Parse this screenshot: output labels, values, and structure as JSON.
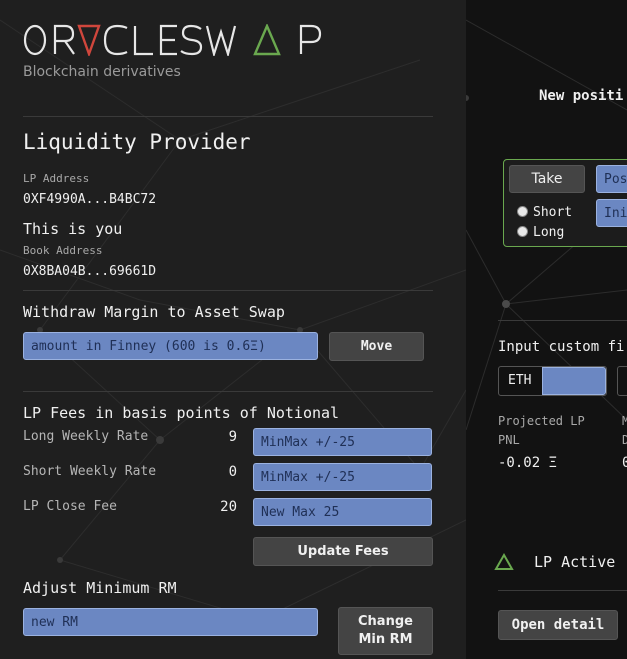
{
  "brand": {
    "logo_text": "ORACLESWAP",
    "tagline": "Blockchain derivatives"
  },
  "lp": {
    "title": "Liquidity Provider",
    "lp_address_label": "LP Address",
    "lp_address": "0XF4990A...B4BC72",
    "this_is_you": "This is you",
    "book_address_label": "Book Address",
    "book_address": "0X8BA04B...69661D"
  },
  "withdraw": {
    "title": "Withdraw Margin to Asset Swap",
    "placeholder": "amount in Finney (600 is 0.6Ξ)",
    "button": "Move"
  },
  "fees": {
    "title": "LP Fees in basis points of Notional",
    "rows": [
      {
        "label": "Long Weekly Rate",
        "value": "9",
        "placeholder": "MinMax +/-25"
      },
      {
        "label": "Short Weekly Rate",
        "value": "0",
        "placeholder": "MinMax +/-25"
      },
      {
        "label": "LP Close Fee",
        "value": "20",
        "placeholder": "New Max 25"
      }
    ],
    "update_button": "Update Fees"
  },
  "rm": {
    "title": "Adjust Minimum RM",
    "placeholder": "new RM",
    "button_line1": "Change",
    "button_line2": "Min RM"
  },
  "right": {
    "new_position": "New positi",
    "take_button": "Take",
    "pos_input": "Pos",
    "ini_input": "Ini",
    "short_label": "Short",
    "long_label": "Long",
    "custom_title": "Input custom fi",
    "eth_label": "ETH",
    "projected_label_1": "Projected LP",
    "projected_label_2": "PNL",
    "projected_value": "-0.02 Ξ",
    "col2_label_1": "M",
    "col2_label_2": "D",
    "col2_value": "0",
    "lp_active": "LP Active",
    "open_detail": "Open detail"
  },
  "colors": {
    "input_blue": "#6b87c2",
    "accent_green": "#6aa84f",
    "accent_red": "#d0463c"
  }
}
